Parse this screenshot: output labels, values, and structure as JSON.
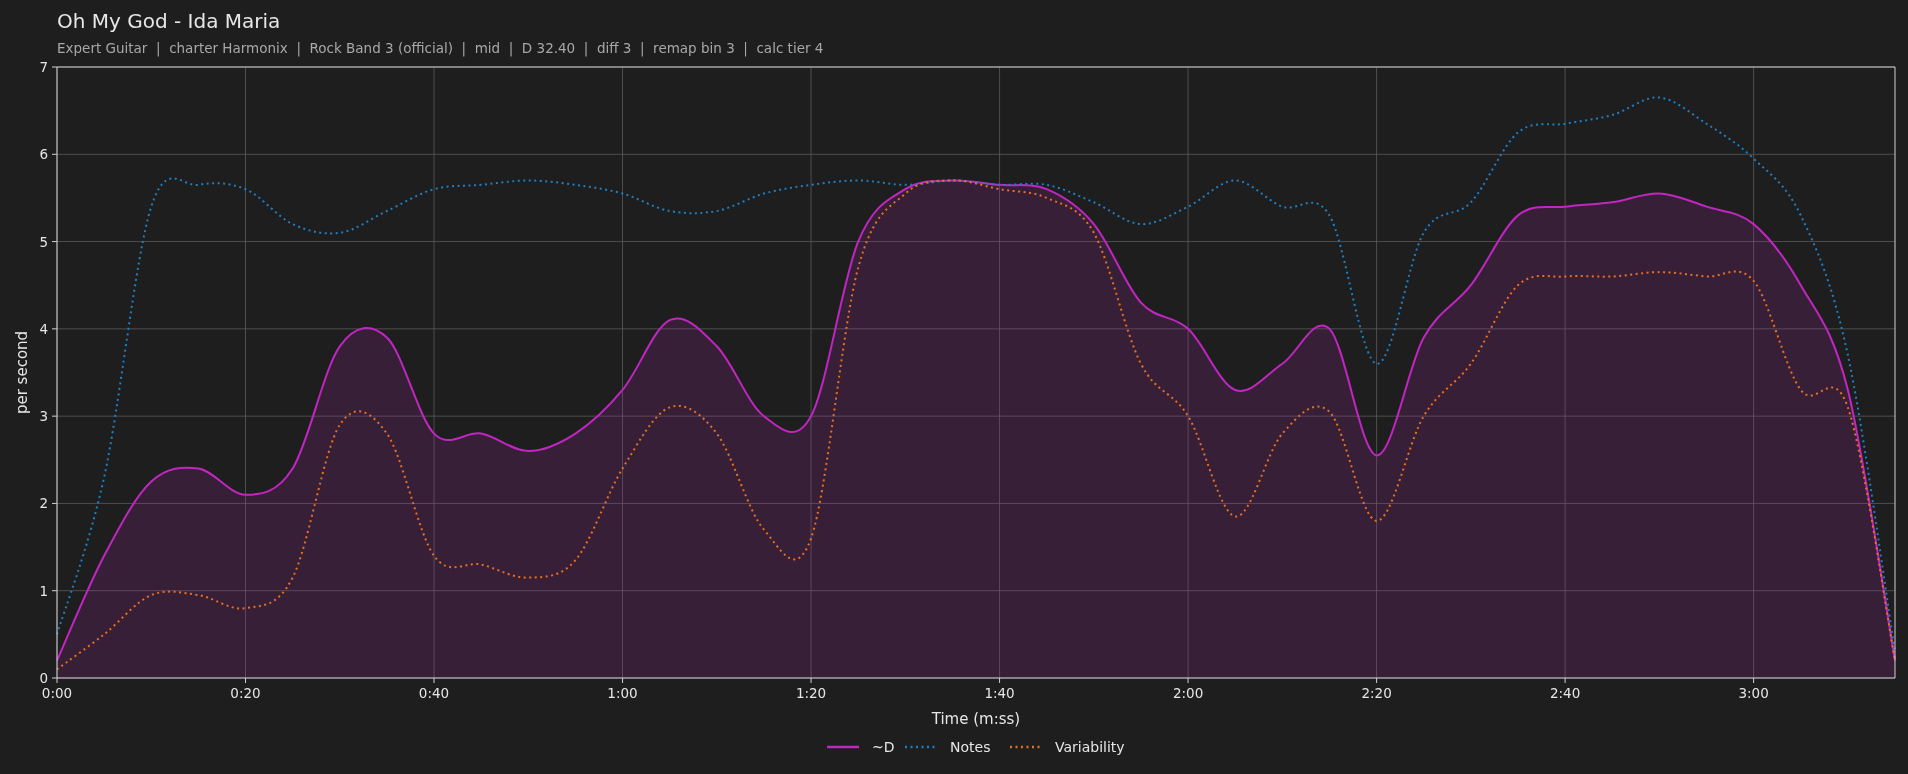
{
  "title": "Oh My God - Ida Maria",
  "subtitle": "Expert Guitar  |  charter Harmonix  |  Rock Band 3 (official)  |  mid  |  D 32.40  |  diff 3  |  remap bin 3  |  calc tier 4",
  "chart_data": {
    "type": "line",
    "xlabel": "Time (m:ss)",
    "ylabel": "per second",
    "x": [
      0,
      5,
      10,
      15,
      20,
      25,
      30,
      35,
      40,
      45,
      50,
      55,
      60,
      65,
      70,
      75,
      80,
      85,
      90,
      95,
      100,
      105,
      110,
      115,
      120,
      125,
      130,
      135,
      140,
      145,
      150,
      155,
      160,
      165,
      170,
      175,
      180,
      185,
      190,
      195
    ],
    "series": [
      {
        "name": "~D",
        "color": "#c026c0",
        "type": "area",
        "line_style": "solid",
        "values": [
          0.2,
          1.4,
          2.25,
          2.4,
          2.1,
          2.4,
          3.8,
          3.9,
          2.8,
          2.8,
          2.6,
          2.8,
          3.3,
          4.1,
          3.8,
          3.0,
          3.0,
          5.0,
          5.6,
          5.7,
          5.65,
          5.6,
          5.2,
          4.3,
          4.0,
          3.3,
          3.6,
          4.0,
          2.55,
          3.9,
          4.5,
          5.3,
          5.4,
          5.45,
          5.55,
          5.4,
          5.2,
          4.5,
          3.3,
          0.2
        ]
      },
      {
        "name": "Notes",
        "color": "#1f7fc4",
        "type": "line",
        "line_style": "dotted",
        "values": [
          0.5,
          2.3,
          5.4,
          5.65,
          5.6,
          5.2,
          5.1,
          5.35,
          5.6,
          5.65,
          5.7,
          5.65,
          5.55,
          5.35,
          5.35,
          5.55,
          5.65,
          5.7,
          5.65,
          5.7,
          5.65,
          5.65,
          5.45,
          5.2,
          5.4,
          5.7,
          5.4,
          5.3,
          3.6,
          5.1,
          5.45,
          6.25,
          6.35,
          6.45,
          6.65,
          6.35,
          5.95,
          5.3,
          3.7,
          0.3
        ]
      },
      {
        "name": "Variability",
        "color": "#e8701e",
        "type": "line",
        "line_style": "dotted",
        "values": [
          0.1,
          0.5,
          0.95,
          0.95,
          0.8,
          1.15,
          2.9,
          2.8,
          1.4,
          1.3,
          1.15,
          1.35,
          2.4,
          3.1,
          2.8,
          1.7,
          1.6,
          4.7,
          5.55,
          5.7,
          5.6,
          5.5,
          5.1,
          3.6,
          3.0,
          1.85,
          2.8,
          3.05,
          1.8,
          3.0,
          3.6,
          4.5,
          4.6,
          4.6,
          4.65,
          4.6,
          4.55,
          3.3,
          3.1,
          0.2
        ]
      }
    ],
    "grid": true,
    "legend": true,
    "xlim": [
      0,
      195
    ],
    "ylim": [
      0,
      7
    ],
    "xticks": [
      {
        "value": 0,
        "label": "0:00"
      },
      {
        "value": 20,
        "label": "0:20"
      },
      {
        "value": 40,
        "label": "0:40"
      },
      {
        "value": 60,
        "label": "1:00"
      },
      {
        "value": 80,
        "label": "1:20"
      },
      {
        "value": 100,
        "label": "1:40"
      },
      {
        "value": 120,
        "label": "2:00"
      },
      {
        "value": 140,
        "label": "2:20"
      },
      {
        "value": 160,
        "label": "2:40"
      },
      {
        "value": 180,
        "label": "3:00"
      }
    ],
    "yticks": [
      0,
      1,
      2,
      3,
      4,
      5,
      6,
      7
    ]
  }
}
